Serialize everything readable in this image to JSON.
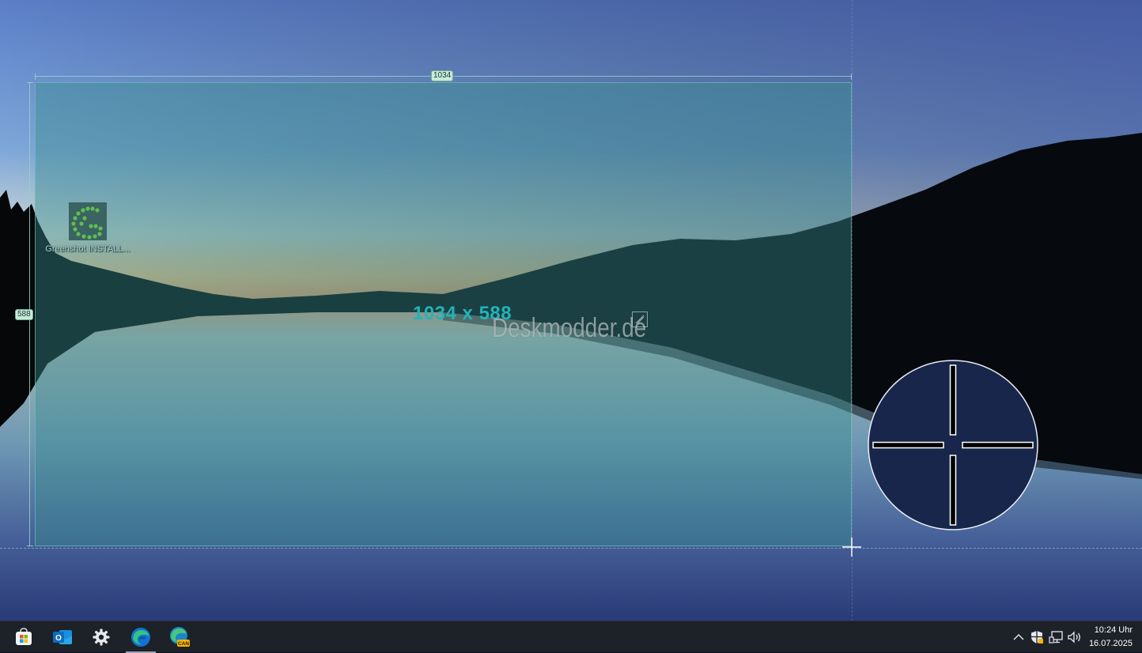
{
  "desktop": {
    "icon_label": "Greenshot INSTALL..."
  },
  "capture": {
    "width_label": "1034",
    "height_label": "588",
    "size_readout": "1034 x 588"
  },
  "watermark": "Deskmodder.de",
  "taskbar": {
    "apps": [
      {
        "name": "Microsoft Store"
      },
      {
        "name": "Outlook",
        "badge": "O"
      },
      {
        "name": "Settings"
      },
      {
        "name": "Microsoft Edge",
        "active": true
      },
      {
        "name": "Microsoft Edge Canary",
        "badge": "CAN"
      }
    ],
    "clock_time": "10:24 Uhr",
    "clock_date": "16.07.2025"
  },
  "colors": {
    "selection_fill": "#368c8c",
    "readout_text": "#22b3b8",
    "taskbar_bg": "#1d2128"
  }
}
